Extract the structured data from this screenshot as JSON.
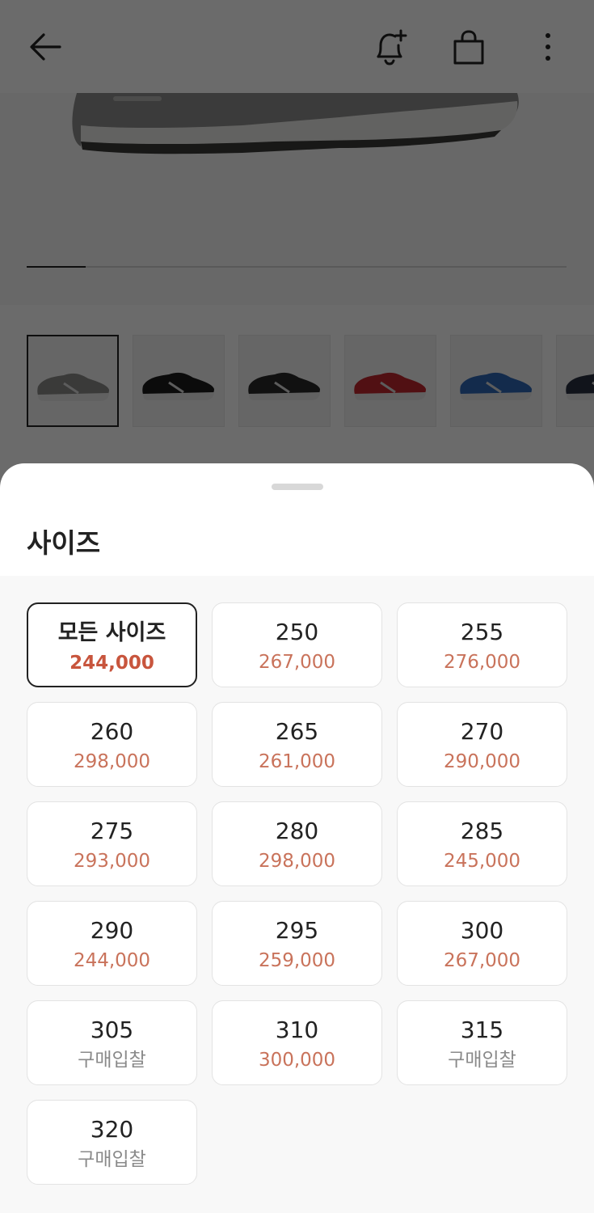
{
  "header": {
    "back_icon": "arrow-left-icon",
    "alert_icon": "bell-plus-icon",
    "cart_icon": "shopping-bag-icon",
    "more_icon": "more-vertical-icon"
  },
  "carousel": {
    "progress": 0.11
  },
  "thumbnails": [
    {
      "color": "#8a8a88",
      "name": "grey"
    },
    {
      "color": "#1c1c1c",
      "name": "black"
    },
    {
      "color": "#2a2a2a",
      "name": "black-grey"
    },
    {
      "color": "#c0282e",
      "name": "red"
    },
    {
      "color": "#2f67b5",
      "name": "blue"
    },
    {
      "color": "#2a3042",
      "name": "navy"
    }
  ],
  "sheet": {
    "title": "사이즈",
    "sizes": [
      {
        "size": "모든 사이즈",
        "price": "244,000",
        "selected": true
      },
      {
        "size": "250",
        "price": "267,000"
      },
      {
        "size": "255",
        "price": "276,000"
      },
      {
        "size": "260",
        "price": "298,000"
      },
      {
        "size": "265",
        "price": "261,000"
      },
      {
        "size": "270",
        "price": "290,000"
      },
      {
        "size": "275",
        "price": "293,000"
      },
      {
        "size": "280",
        "price": "298,000"
      },
      {
        "size": "285",
        "price": "245,000"
      },
      {
        "size": "290",
        "price": "244,000"
      },
      {
        "size": "295",
        "price": "259,000"
      },
      {
        "size": "300",
        "price": "267,000"
      },
      {
        "size": "305",
        "price": "구매입찰",
        "bid": true
      },
      {
        "size": "310",
        "price": "300,000"
      },
      {
        "size": "315",
        "price": "구매입찰",
        "bid": true
      },
      {
        "size": "320",
        "price": "구매입찰",
        "bid": true
      }
    ]
  },
  "colors": {
    "price": "#c9735b",
    "price_selected": "#c8553d",
    "bid": "#8a8a8a"
  }
}
